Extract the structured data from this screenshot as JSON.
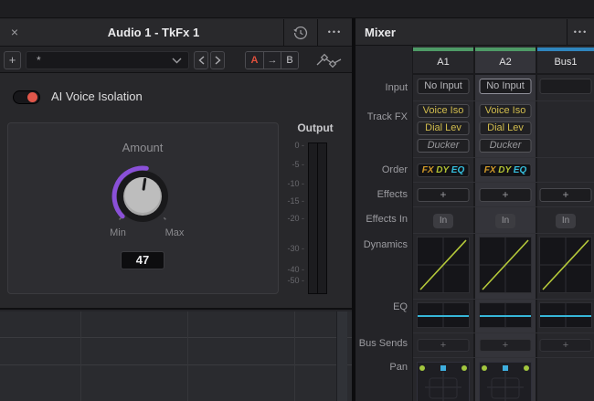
{
  "window": {
    "title": "Audio 1 - TkFx 1",
    "close_glyph": "×",
    "menu_dots": "•••",
    "toolbar": {
      "add_label": "+",
      "preset_value": "*",
      "ab_a": "A",
      "ab_arrow": "→",
      "ab_b": "B"
    },
    "plugin": {
      "toggle_label": "AI Voice Isolation",
      "knob_label": "Amount",
      "min_label": "Min",
      "max_label": "Max",
      "value": "47"
    },
    "meter": {
      "label": "Output",
      "ticks": [
        "0",
        "-5",
        "-10",
        "-15",
        "-20",
        "-30",
        "-40",
        "-50"
      ]
    }
  },
  "mixer": {
    "title": "Mixer",
    "menu_dots": "•••",
    "row_labels": [
      "Input",
      "Track FX",
      "Order",
      "Effects",
      "Effects In",
      "Dynamics",
      "EQ",
      "Bus Sends",
      "Pan"
    ],
    "order": {
      "fx": "FX",
      "dy": "DY",
      "eq": "EQ"
    },
    "effects_plus": "+",
    "bus_sends_plus": "+",
    "effects_in_label": "In",
    "channels": [
      {
        "name": "A1",
        "strip_color": "#4e9a66",
        "input": "No Input",
        "track_fx": [
          "Voice Iso",
          "Dial Lev",
          "Ducker"
        ],
        "selected": false
      },
      {
        "name": "A2",
        "strip_color": "#4e9a66",
        "input": "No Input",
        "track_fx": [
          "Voice Iso",
          "Dial Lev",
          "Ducker"
        ],
        "selected": true
      },
      {
        "name": "Bus1",
        "strip_color": "#2f85bd",
        "input": "",
        "track_fx": [],
        "selected": false
      }
    ]
  },
  "chart_data": {
    "type": "line",
    "note": "dynamics transfer curves and EQ response lines shown as flat defaults",
    "knob_value": 47
  },
  "colors": {
    "accent_red": "#e0503c",
    "knob_purple": "#8a50d8",
    "channel_green": "#4e9a66",
    "bus_blue": "#2f85bd",
    "fx_yellow": "#d2bd4e",
    "order_fx": "#d29a28",
    "order_dy": "#b2c233",
    "order_eq": "#35bedd",
    "eq_cyan": "#36b6d8",
    "dynamics_line": "#b6ca3a",
    "pan_dot_green": "#a2c63e",
    "pan_dot_blue": "#3eaede"
  }
}
